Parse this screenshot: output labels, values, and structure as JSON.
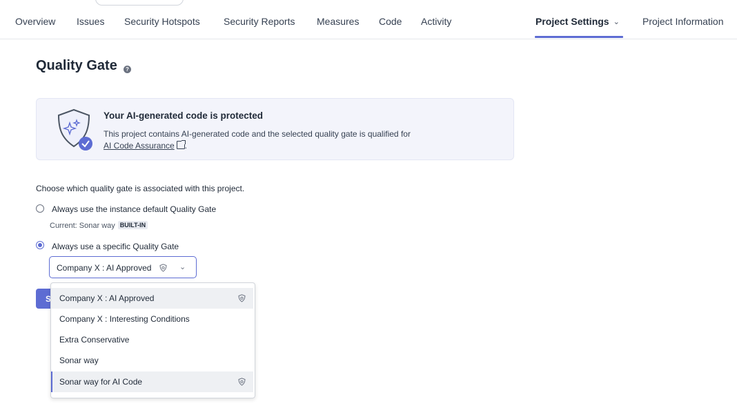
{
  "nav": {
    "tabs": [
      {
        "label": "Overview"
      },
      {
        "label": "Issues"
      },
      {
        "label": "Security Hotspots"
      },
      {
        "label": "Security Reports"
      },
      {
        "label": "Measures"
      },
      {
        "label": "Code"
      },
      {
        "label": "Activity"
      }
    ],
    "settings_label": "Project Settings",
    "info_label": "Project Information"
  },
  "page": {
    "title": "Quality Gate",
    "help_glyph": "?"
  },
  "banner": {
    "title": "Your AI-generated code is protected",
    "text": "This project contains AI-generated code and the selected quality gate is qualified for",
    "link": "AI Code Assurance",
    "suffix": ".",
    "icon": "ai-shield-check-icon"
  },
  "form": {
    "intro": "Choose which quality gate is associated with this project.",
    "option_default": "Always use the instance default Quality Gate",
    "current_label": "Current: Sonar way",
    "current_badge": "BUILT-IN",
    "option_specific": "Always use a specific Quality Gate",
    "selected_value": "Company X : AI Approved",
    "save_label": "S"
  },
  "dropdown": {
    "options": [
      {
        "label": "Company X : AI Approved",
        "ai": true
      },
      {
        "label": "Company X : Interesting Conditions",
        "ai": false
      },
      {
        "label": "Extra Conservative",
        "ai": false
      },
      {
        "label": "Sonar way",
        "ai": false
      },
      {
        "label": "Sonar way for AI Code",
        "ai": true
      }
    ]
  },
  "colors": {
    "accent": "#5d6cd3",
    "banner_bg": "#f3f4fb"
  }
}
